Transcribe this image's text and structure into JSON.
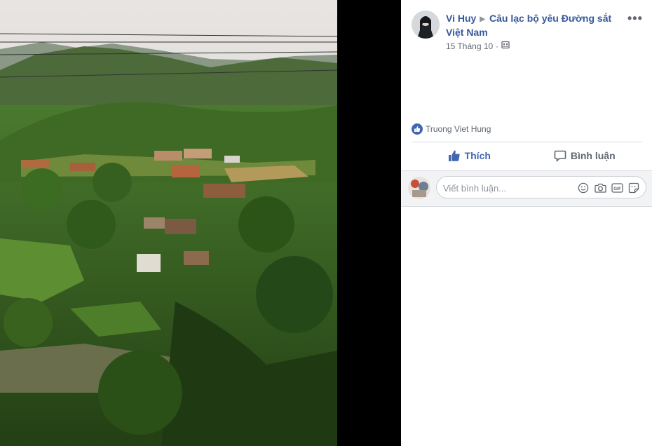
{
  "post": {
    "author": "Vi Huy",
    "group": "Câu lạc bộ yêu Đường sắt Việt Nam",
    "date": "15 Tháng 10",
    "dot": "·",
    "reaction_user": "Truong Viet Hung"
  },
  "actions": {
    "like_label": "Thích",
    "comment_label": "Bình luận"
  },
  "comment_box": {
    "placeholder": "Viết bình luận..."
  },
  "icons": {
    "more": "more-options-icon",
    "privacy": "audience-icon",
    "like": "thumbs-up-icon",
    "comment": "comment-bubble-icon",
    "emoji": "emoji-icon",
    "camera": "camera-icon",
    "gif": "gif-icon",
    "sticker": "sticker-icon"
  },
  "colors": {
    "brand": "#4267b2",
    "link": "#365899",
    "muted": "#616770"
  }
}
